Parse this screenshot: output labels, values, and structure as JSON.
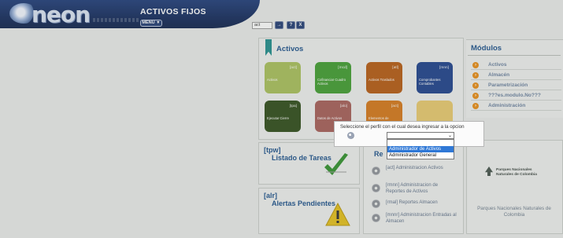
{
  "header": {
    "logo": "neon",
    "title": "ACTIVOS FIJOS",
    "menu_label": "MENU ▼",
    "search_value": "act",
    "buttons": [
      "→",
      "?",
      "X"
    ]
  },
  "activos": {
    "title": "Activos",
    "tiles": [
      {
        "code": "[act]",
        "name": "Activos",
        "color": "#a8bf58"
      },
      {
        "code": "[mcd]",
        "name": "Cofinanciar Cuadro Activos",
        "color": "#3f9c2e"
      },
      {
        "code": "[atl]",
        "name": "Activos Traslados",
        "color": "#b5580f"
      },
      {
        "code": "[mnn]",
        "name": "Comprobantes Contables",
        "color": "#1b3f8a"
      },
      {
        "code": "[tpa]",
        "name": "Ejecutar Cierre",
        "color": "#2d4a16"
      },
      {
        "code": "[alo]",
        "name": "Datos de Activos",
        "color": "#a55c56"
      },
      {
        "code": "[act]",
        "name": "Elementos de",
        "color": "#d57616"
      },
      {
        "code": "",
        "name": "",
        "color": "#e8c86c"
      }
    ]
  },
  "tareas": {
    "code": "[tpw]",
    "title": "Listado de Tareas"
  },
  "alertas": {
    "code": "[alr]",
    "title": "Alertas Pendientes"
  },
  "reportes": {
    "title": "Re",
    "items": [
      "[act] Administracion Activos",
      "[rmnn] Administracion de Reportes de Activos",
      "[rmal] Reportes Almacen",
      "[mnnr] Administracion Entradas al Almacen"
    ]
  },
  "modulos": {
    "title": "Módulos",
    "items": [
      "Activos",
      "Almacén",
      "Parametrización",
      "???es.modulo.No???",
      "Administración"
    ]
  },
  "parks": {
    "logo_text": "Parques Nacionales Naturales de Colombia",
    "caption": "Parques Nacionales Naturales de Colombia"
  },
  "modal": {
    "title": "Seleccione el perfil con el cual desea ingresar a la opcion",
    "options": [
      "",
      "Administrador de Activos",
      "Administrador General"
    ],
    "highlighted": "Administrador de Activos"
  },
  "colors": {
    "brand": "#0f2556",
    "accent": "#1a4f8a",
    "module_arrow": "#e88a12",
    "selection": "#2f78d6"
  }
}
